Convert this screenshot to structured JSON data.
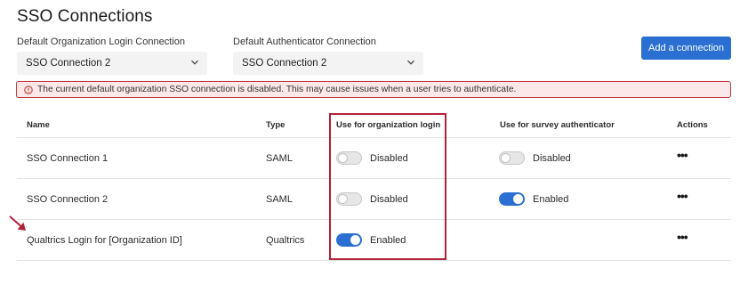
{
  "header": {
    "title": "SSO Connections"
  },
  "defaults": {
    "org_login_label": "Default Organization Login Connection",
    "org_login_value": "SSO Connection 2",
    "authenticator_label": "Default Authenticator Connection",
    "authenticator_value": "SSO Connection 2"
  },
  "toolbar": {
    "add_label": "Add a connection"
  },
  "alert": {
    "message": "The current default organization SSO connection is disabled. This may cause issues when a user tries to authenticate."
  },
  "table": {
    "headers": {
      "name": "Name",
      "type": "Type",
      "org_login": "Use for organization login",
      "survey_auth": "Use for survey authenticator",
      "actions": "Actions"
    },
    "rows": [
      {
        "name": "SSO Connection 1",
        "type": "SAML",
        "org_login": "Disabled",
        "survey_auth": "Disabled",
        "actions": "•••"
      },
      {
        "name": "SSO Connection 2",
        "type": "SAML",
        "org_login": "Disabled",
        "survey_auth": "Enabled",
        "actions": "•••"
      },
      {
        "name": "Qualtrics Login for [Organization ID]",
        "type": "Qualtrics",
        "org_login": "Enabled",
        "survey_auth": "",
        "actions": "•••"
      }
    ]
  },
  "colors": {
    "accent": "#2a6fd1",
    "alert_border": "#c0393b",
    "alert_bg": "#fce8e8",
    "highlight": "#b3203a"
  },
  "icons": {
    "dropdown": "chevron-down-icon",
    "alert": "alert-circle-icon",
    "actions": "more-horizontal-icon",
    "annotation": "arrow-icon"
  }
}
